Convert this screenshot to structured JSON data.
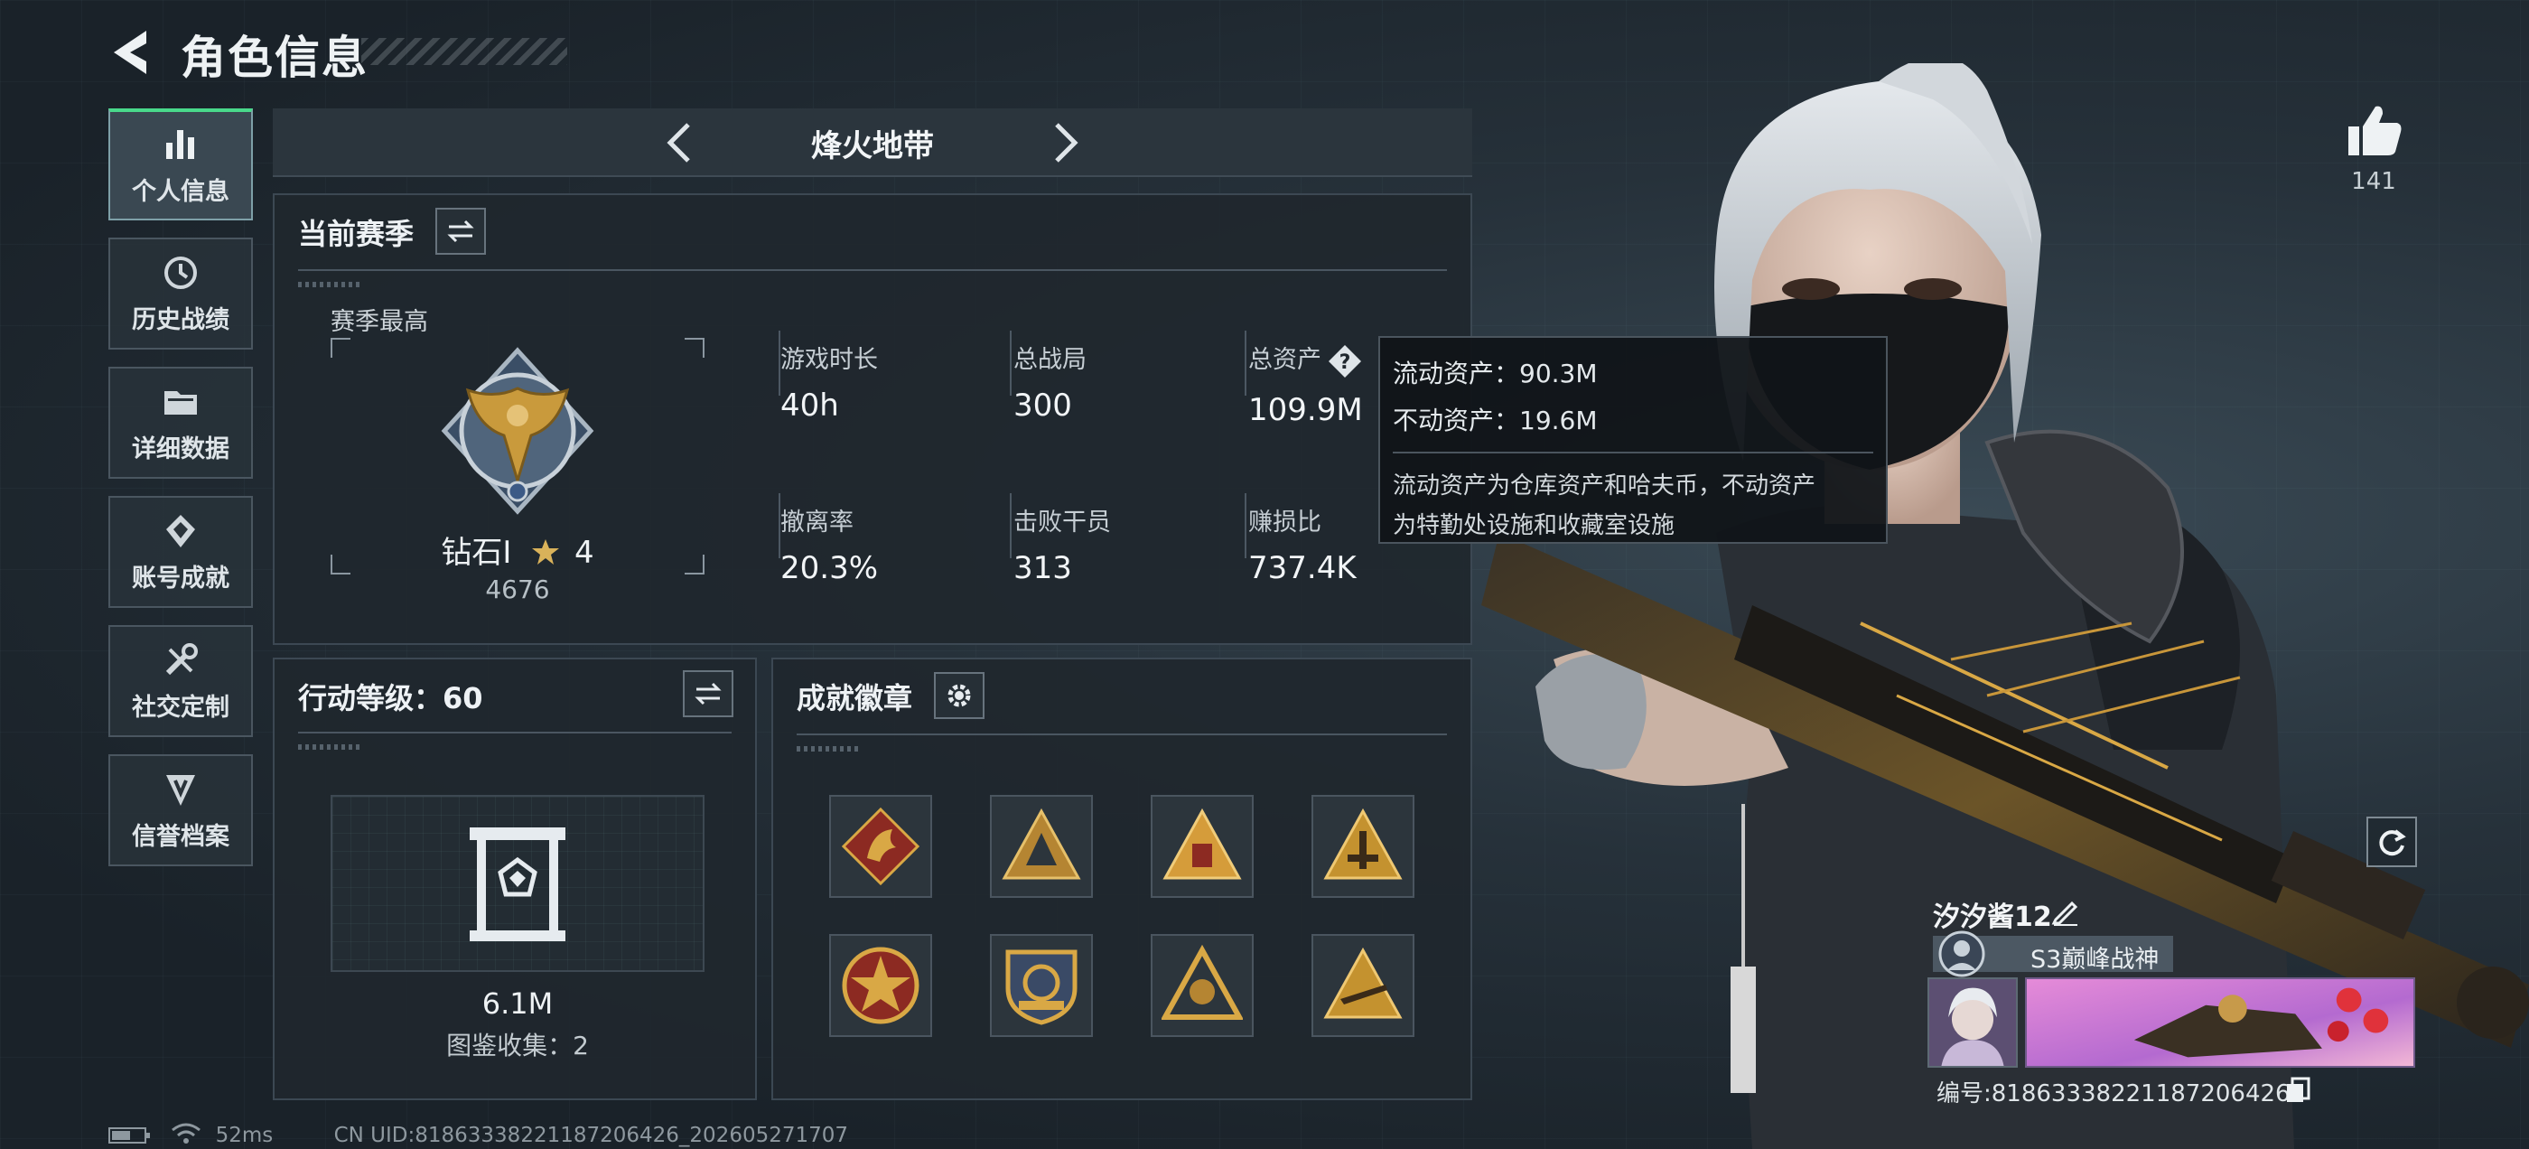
{
  "header": {
    "title": "角色信息"
  },
  "sidebar": {
    "items": [
      {
        "label": "个人信息",
        "icon": "bar-chart-icon",
        "active": true
      },
      {
        "label": "历史战绩",
        "icon": "history-icon",
        "active": false
      },
      {
        "label": "详细数据",
        "icon": "folder-icon",
        "active": false
      },
      {
        "label": "账号成就",
        "icon": "achievement-icon",
        "active": false
      },
      {
        "label": "社交定制",
        "icon": "wrench-icon",
        "active": false
      },
      {
        "label": "信誉档案",
        "icon": "shield-icon",
        "active": false
      }
    ]
  },
  "mode": {
    "title": "烽火地带"
  },
  "season": {
    "title": "当前赛季",
    "best_label": "赛季最高",
    "rank_name": "钻石Ⅰ",
    "rank_stars": "4",
    "rank_score": "4676",
    "stats": [
      {
        "label": "游戏时长",
        "value": "40h"
      },
      {
        "label": "总战局",
        "value": "300"
      },
      {
        "label": "总资产",
        "value": "109.9M"
      },
      {
        "label": "撤离率",
        "value": "20.3%"
      },
      {
        "label": "击败干员",
        "value": "313"
      },
      {
        "label": "赚损比",
        "value": "737.4K"
      }
    ]
  },
  "tooltip": {
    "liquid": "流动资产：90.3M",
    "fixed": "不动资产：19.6M",
    "desc_line1": "流动资产为仓库资产和哈夫币，不动资产",
    "desc_line2": "为特勤处设施和收藏室设施"
  },
  "level": {
    "title": "行动等级：60",
    "codex_value": "6.1M",
    "codex_count": "图鉴收集：2"
  },
  "badges": {
    "title": "成就徽章",
    "items": [
      "badge-dragon",
      "badge-triangle-emblem",
      "badge-triangle-red",
      "badge-triangle-tower",
      "badge-star-round",
      "badge-shield-tank",
      "badge-triangle-gold",
      "badge-triangle-gun"
    ]
  },
  "likes": {
    "count": "141"
  },
  "player": {
    "name": "汐汐酱12",
    "title": "S3巅峰战神",
    "uid": "编号:8186333822118720642​6"
  },
  "footer": {
    "ping": "52ms",
    "uid": "CN UID:8186333822118720642​6_202605271707"
  },
  "colors": {
    "accent_green": "#49d98b",
    "badge_gold": "#c99a3c",
    "badge_red": "#8c2a22"
  }
}
